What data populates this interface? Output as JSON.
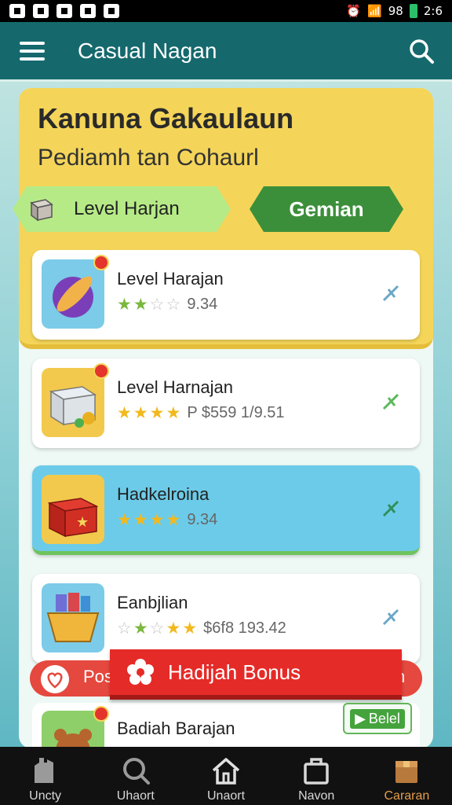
{
  "status_bar": {
    "time_left": "98",
    "time_right": "2:6"
  },
  "app_bar": {
    "title": "Casual Nagan"
  },
  "hero": {
    "title": "Kanuna Gakaulaun",
    "subtitle": "Pediamh tan Cohaurl",
    "pill_left": "Level Harjan",
    "pill_right": "Gemian"
  },
  "cards": [
    {
      "title": "Level Harajan",
      "rating": "9.34",
      "stars": [
        "g",
        "g",
        "off",
        "off"
      ]
    },
    {
      "title": "Level Harnajan",
      "rating": "P $559 1/9.51",
      "stars": [
        "on",
        "on",
        "on",
        "on"
      ]
    },
    {
      "title": "Hadkelroina",
      "rating": "9.34",
      "stars": [
        "on",
        "on",
        "on",
        "on"
      ]
    },
    {
      "title": "Eanbjlian",
      "rating": "$6f8 193.42",
      "stars": [
        "off",
        "g",
        "off",
        "on",
        "on"
      ]
    },
    {
      "title": "Badiah Barajan"
    }
  ],
  "banner": {
    "left_text": "Pos",
    "right_text": "n"
  },
  "bonus": {
    "label": "Hadijah Bonus"
  },
  "select_button": {
    "label": "Belel"
  },
  "nav": [
    {
      "label": "Uncty"
    },
    {
      "label": "Uhaort"
    },
    {
      "label": "Unaort"
    },
    {
      "label": "Navon"
    },
    {
      "label": "Cararan"
    }
  ],
  "colors": {
    "app_bar": "#15696d",
    "hero": "#f4d559",
    "accent_green": "#3c8f3a",
    "bonus_red": "#e52b28",
    "active_nav": "#e59d4b"
  }
}
